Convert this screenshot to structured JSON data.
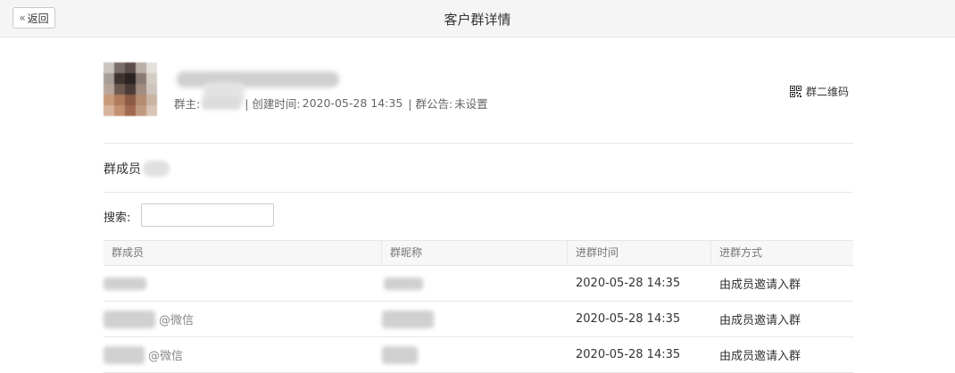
{
  "header": {
    "back_label": "返回",
    "back_icon": "«",
    "title": "客户群详情"
  },
  "group": {
    "owner_label": "群主:",
    "created_label": "| 创建时间:",
    "created_time": "2020-05-28 14:35",
    "announcement_label": "| 群公告:",
    "announcement_value": "未设置",
    "qr_label": "群二维码"
  },
  "members": {
    "title": "群成员"
  },
  "search": {
    "label": "搜索:",
    "value": "",
    "placeholder": ""
  },
  "table": {
    "columns": [
      "群成员",
      "群昵称",
      "进群时间",
      "进群方式"
    ],
    "rows": [
      {
        "suffix": "",
        "time": "2020-05-28 14:35",
        "method": "由成员邀请入群"
      },
      {
        "suffix": "@微信",
        "time": "2020-05-28 14:35",
        "method": "由成员邀请入群"
      },
      {
        "suffix": "@微信",
        "time": "2020-05-28 14:35",
        "method": "由成员邀请入群"
      }
    ]
  }
}
